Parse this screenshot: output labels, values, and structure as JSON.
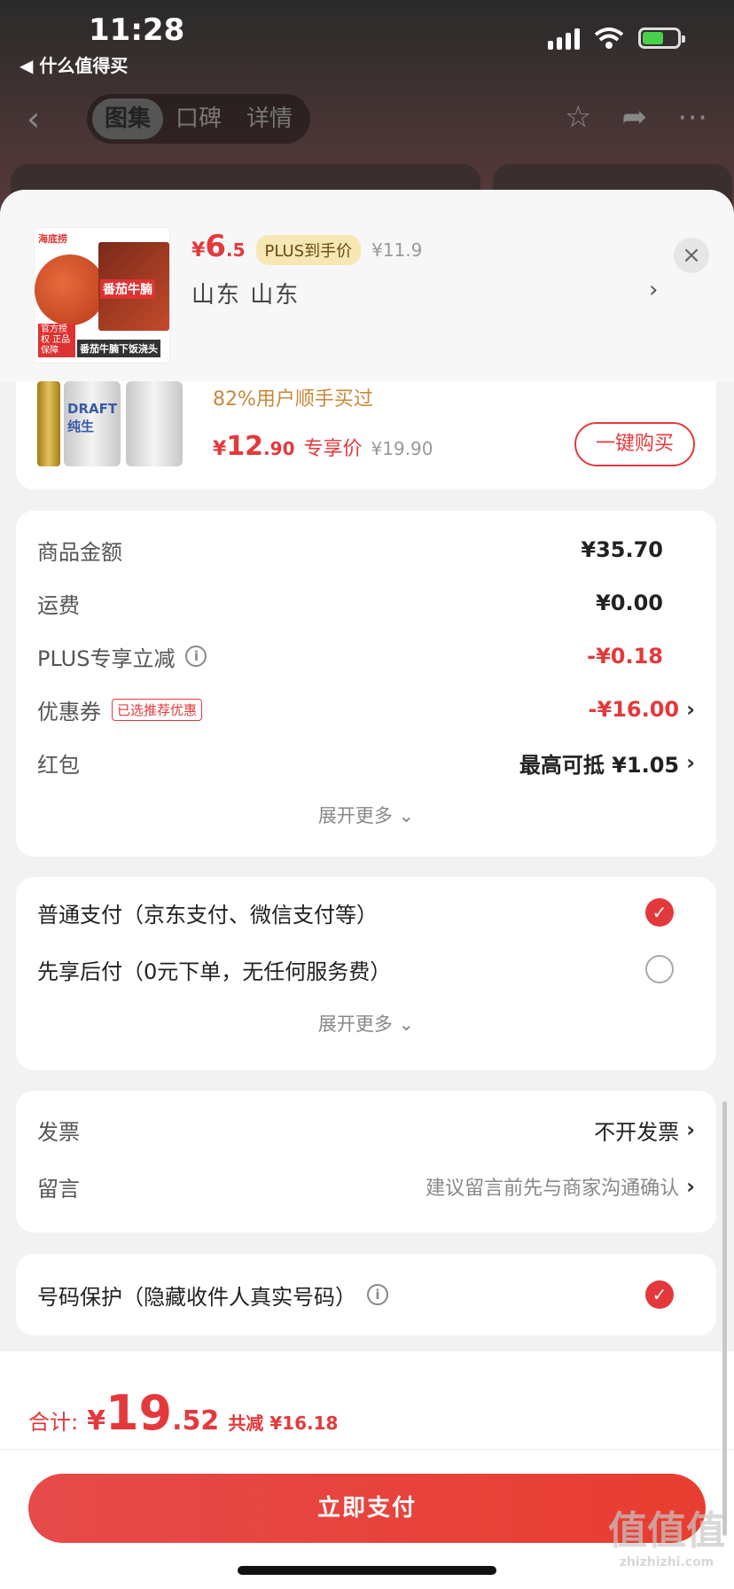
{
  "status_bar": {
    "time": "11:28",
    "back_app": "◀ 什么值得买"
  },
  "nav": {
    "tabs": [
      "图集",
      "口碑",
      "详情"
    ]
  },
  "sku": {
    "brand": "海底捞",
    "img_title": "番茄牛腩",
    "img_tag_a": "官方授权 正品保障",
    "img_tag_b": "番茄牛腩下饭浇头",
    "price_yen": "¥",
    "price_int": "6",
    "price_dec": ".5",
    "plus_label": "PLUS到手价",
    "orig_price": "¥11.9",
    "location": "山东  山东"
  },
  "recommend": {
    "sold": "82%用户顺手买过",
    "price_yen": "¥",
    "price_int": "12",
    "price_dec": ".90",
    "price_note": "专享价",
    "orig_price": "¥19.90",
    "buy_button": "一键购买",
    "can_label": "DRAFT 纯生"
  },
  "summary": {
    "goods_label": "商品金额",
    "goods_value": "¥35.70",
    "shipping_label": "运费",
    "shipping_value": "¥0.00",
    "plus_label": "PLUS专享立减",
    "plus_value": "-¥0.18",
    "coupon_label": "优惠券",
    "coupon_tag": "已选推荐优惠",
    "coupon_value": "-¥16.00",
    "redpacket_label": "红包",
    "redpacket_value": "最高可抵 ¥1.05",
    "expand": "展开更多 ⌄"
  },
  "payment": {
    "option1": "普通支付（京东支付、微信支付等）",
    "option2": "先享后付（0元下单，无任何服务费）",
    "expand": "展开更多 ⌄"
  },
  "invoice": {
    "invoice_label": "发票",
    "invoice_value": "不开发票",
    "note_label": "留言",
    "note_placeholder": "建议留言前先与商家沟通确认"
  },
  "protection": {
    "label": "号码保护（隐藏收件人真实号码）"
  },
  "footer": {
    "total_label": "合计:",
    "yen": "¥",
    "total_int": "19",
    "total_dec": ".52",
    "saved": "共减 ¥16.18",
    "pay_button": "立即支付"
  },
  "watermark": {
    "text": "值值值",
    "url": "zhizhizhi.com"
  },
  "colors": {
    "accent": "#e4393c",
    "plus_pill": "#f6e7b4"
  }
}
